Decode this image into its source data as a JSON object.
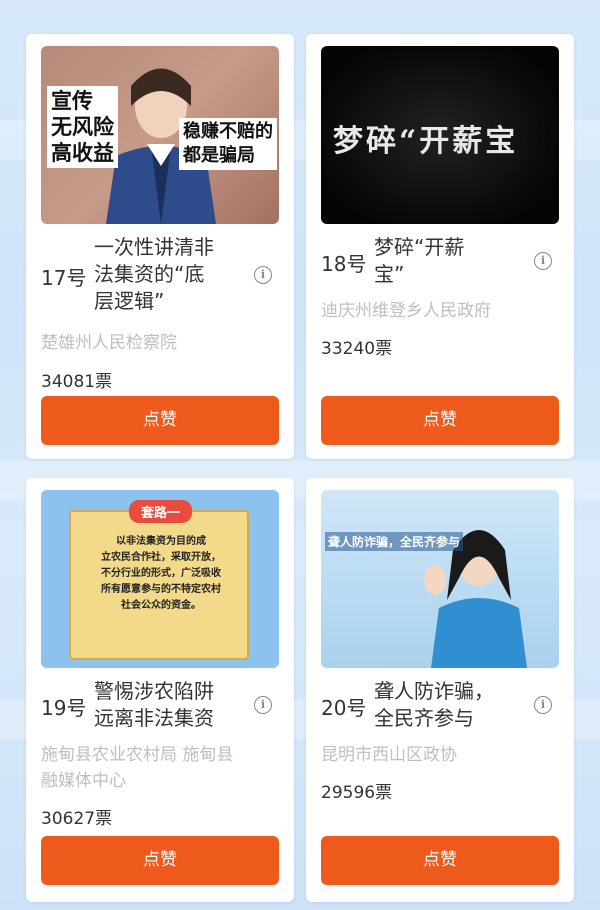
{
  "cards": [
    {
      "number": "17号",
      "title": "一次性讲清非法集资的“底层逻辑”",
      "title_lines": [
        "一次性讲清非",
        "法集资的“底",
        "层逻辑”"
      ],
      "org_lines": [
        "楚雄州人民检察院"
      ],
      "votes": "34081票",
      "like_label": "点赞",
      "thumb": {
        "left_text": [
          "宣传",
          "无风险",
          "高收益"
        ],
        "right_text": [
          "稳赚不赔的",
          "都是骗局"
        ]
      }
    },
    {
      "number": "18号",
      "title": "梦碎“开薪宝”",
      "title_lines": [
        "梦碎“开薪",
        "宝”"
      ],
      "org_lines": [
        "迪庆州维登乡人民政府"
      ],
      "votes": "33240票",
      "like_label": "点赞",
      "thumb": {
        "text": "梦碎“开薪宝"
      }
    },
    {
      "number": "19号",
      "title": "警惕涉农陷阱 远离非法集资",
      "title_lines": [
        "警惕涉农陷阱",
        "远离非法集资"
      ],
      "org_lines": [
        "施甸县农业农村局 施甸县",
        "融媒体中心"
      ],
      "votes": "30627票",
      "like_label": "点赞",
      "thumb": {
        "tag": "套路一",
        "text_lines": [
          "以非法集资为目的成",
          "立农民合作社，采取开放，",
          "不分行业的形式，广泛吸收",
          "所有愿意参与的不特定农村",
          "社会公众的资金。"
        ]
      }
    },
    {
      "number": "20号",
      "title": "聋人防诈骗，全民齐参与",
      "title_lines": [
        "聋人防诈骗，",
        "全民齐参与"
      ],
      "org_lines": [
        "昆明市西山区政协"
      ],
      "votes": "29596票",
      "like_label": "点赞",
      "thumb": {
        "text": "聋人防诈骗，全民齐参与"
      }
    }
  ],
  "colors": {
    "button": "#ee5a1c",
    "background": "#d7e9fb",
    "card": "#ffffff"
  },
  "icons": {
    "info": "info-icon"
  }
}
